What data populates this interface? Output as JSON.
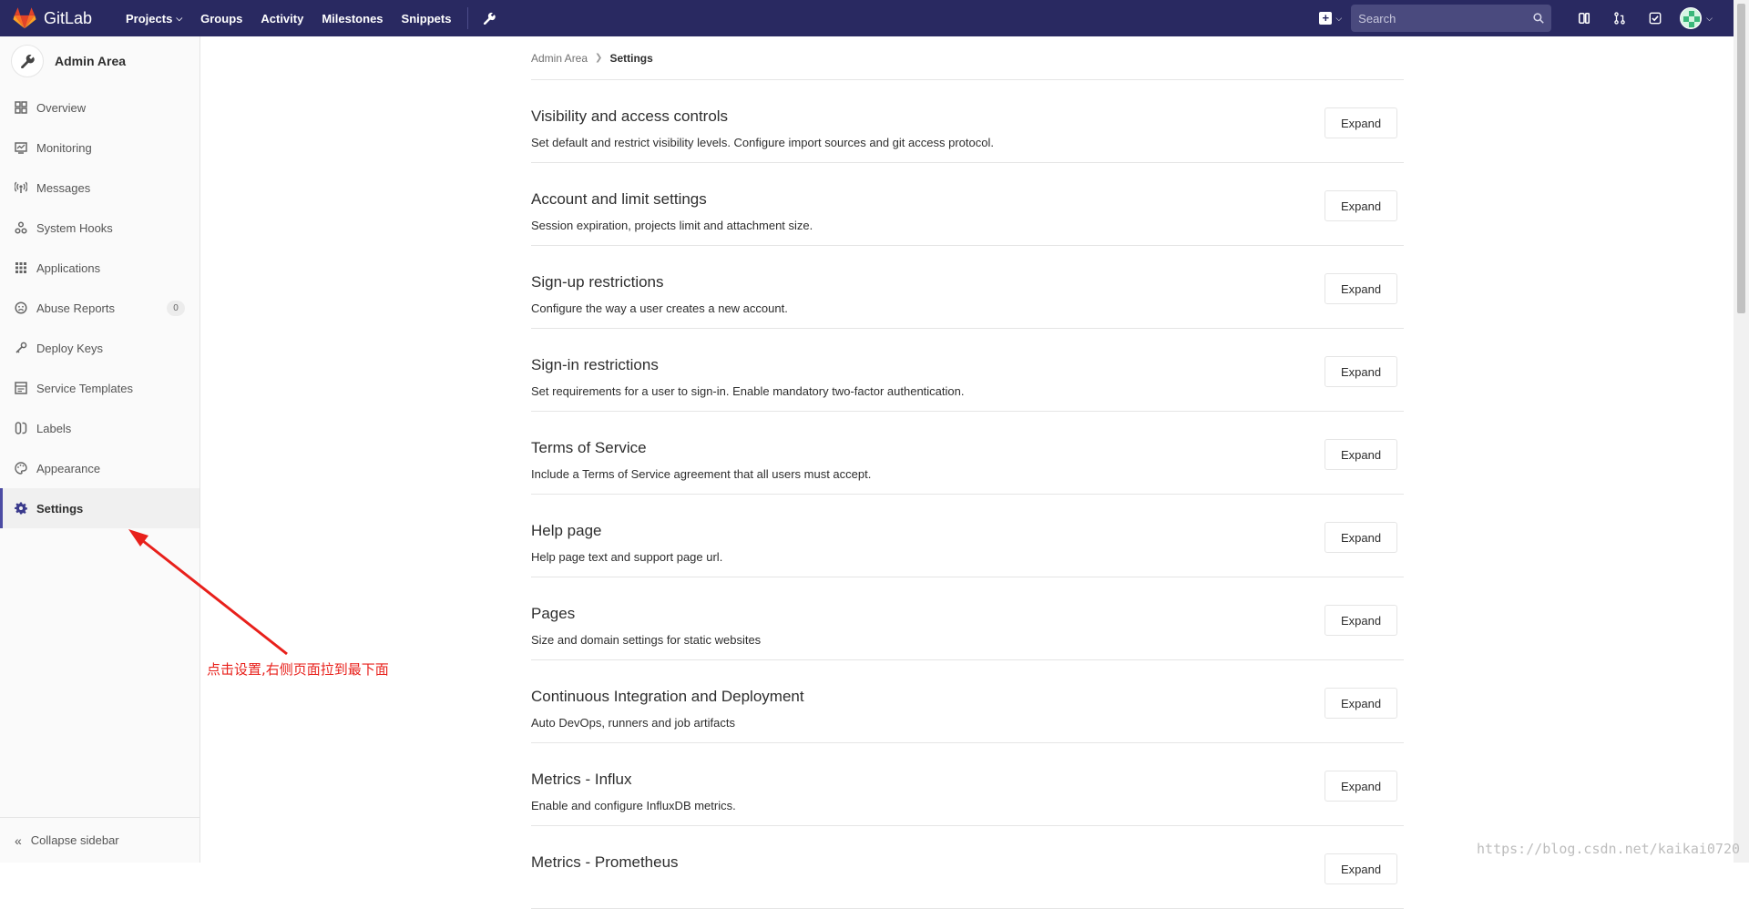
{
  "navbar": {
    "brand": "GitLab",
    "links": [
      {
        "label": "Projects",
        "caret": "⌄"
      },
      {
        "label": "Groups",
        "caret": ""
      },
      {
        "label": "Activity",
        "caret": ""
      },
      {
        "label": "Milestones",
        "caret": ""
      },
      {
        "label": "Snippets",
        "caret": ""
      }
    ],
    "search_placeholder": "Search",
    "icons": [
      "plus-icon",
      "wrench-icon",
      "search-icon",
      "issues-icon",
      "merge-request-icon",
      "todo-icon",
      "avatar"
    ],
    "background": "#292961"
  },
  "sidebar": {
    "context_title": "Admin Area",
    "items": [
      {
        "label": "Overview",
        "icon": "overview-icon",
        "active": false
      },
      {
        "label": "Monitoring",
        "icon": "monitoring-icon",
        "active": false
      },
      {
        "label": "Messages",
        "icon": "messages-icon",
        "active": false
      },
      {
        "label": "System Hooks",
        "icon": "hooks-icon",
        "active": false
      },
      {
        "label": "Applications",
        "icon": "applications-icon",
        "active": false
      },
      {
        "label": "Abuse Reports",
        "icon": "abuse-icon",
        "active": false,
        "badge": "0"
      },
      {
        "label": "Deploy Keys",
        "icon": "key-icon",
        "active": false
      },
      {
        "label": "Service Templates",
        "icon": "templates-icon",
        "active": false
      },
      {
        "label": "Labels",
        "icon": "labels-icon",
        "active": false
      },
      {
        "label": "Appearance",
        "icon": "appearance-icon",
        "active": false
      },
      {
        "label": "Settings",
        "icon": "gear-icon",
        "active": true
      }
    ],
    "collapse_label": "Collapse sidebar"
  },
  "breadcrumb": {
    "parent": "Admin Area",
    "current": "Settings"
  },
  "sections": [
    {
      "title": "Visibility and access controls",
      "description": "Set default and restrict visibility levels. Configure import sources and git access protocol.",
      "button": "Expand"
    },
    {
      "title": "Account and limit settings",
      "description": "Session expiration, projects limit and attachment size.",
      "button": "Expand"
    },
    {
      "title": "Sign-up restrictions",
      "description": "Configure the way a user creates a new account.",
      "button": "Expand"
    },
    {
      "title": "Sign-in restrictions",
      "description": "Set requirements for a user to sign-in. Enable mandatory two-factor authentication.",
      "button": "Expand"
    },
    {
      "title": "Terms of Service",
      "description": "Include a Terms of Service agreement that all users must accept.",
      "button": "Expand"
    },
    {
      "title": "Help page",
      "description": "Help page text and support page url.",
      "button": "Expand"
    },
    {
      "title": "Pages",
      "description": "Size and domain settings for static websites",
      "button": "Expand"
    },
    {
      "title": "Continuous Integration and Deployment",
      "description": "Auto DevOps, runners and job artifacts",
      "button": "Expand"
    },
    {
      "title": "Metrics - Influx",
      "description": "Enable and configure InfluxDB metrics.",
      "button": "Expand"
    },
    {
      "title": "Metrics - Prometheus",
      "description": "",
      "button": "Expand"
    }
  ],
  "annotation": {
    "text": "点击设置,右侧页面拉到最下面",
    "color": "#e8201b"
  },
  "watermark": "https://blog.csdn.net/kaikai0720"
}
